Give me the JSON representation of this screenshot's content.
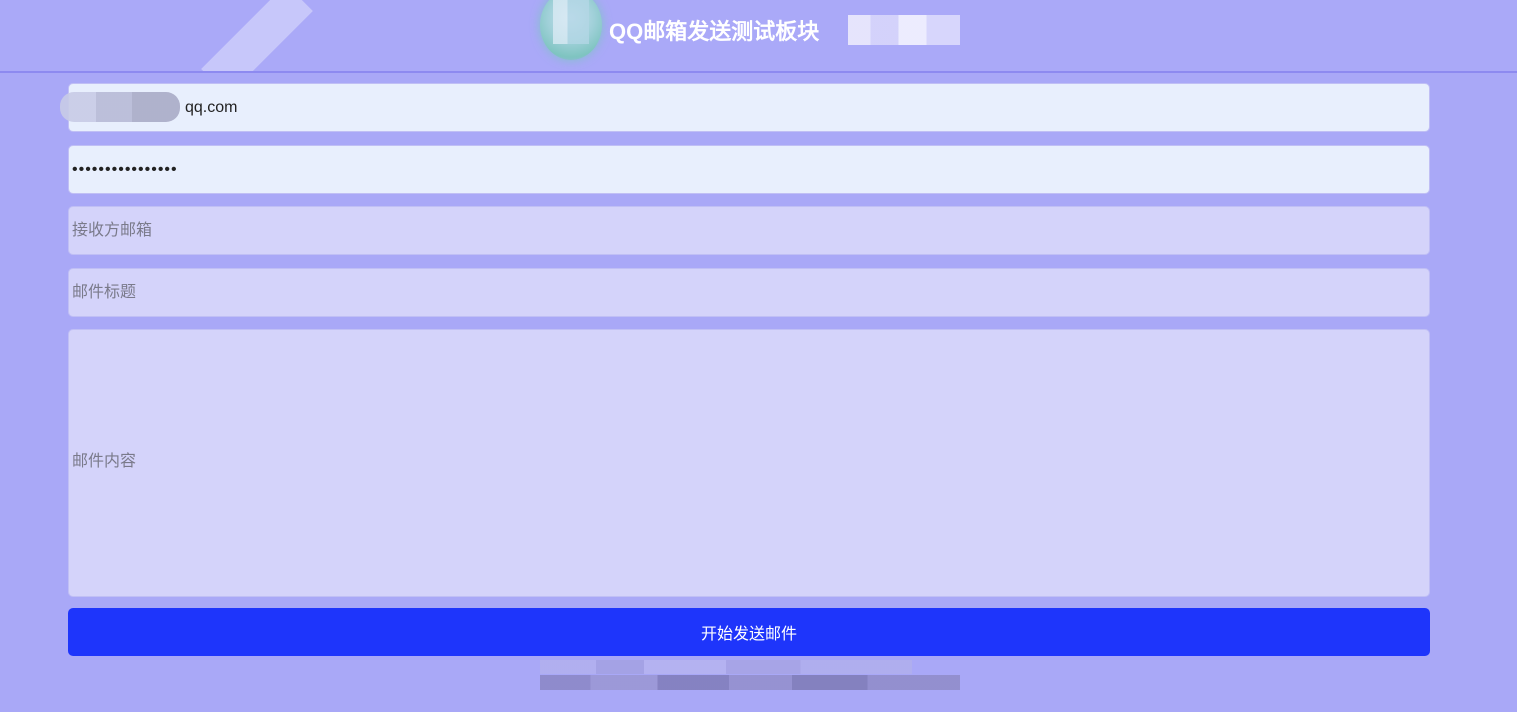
{
  "header": {
    "title": "QQ邮箱发送测试板块"
  },
  "form": {
    "email_value": "qq.com",
    "password_value": "••••••••••••••••",
    "recipient_placeholder": "接收方邮箱",
    "subject_placeholder": "邮件标题",
    "content_placeholder": "邮件内容",
    "send_label": "开始发送邮件"
  },
  "colors": {
    "background": "#a9a8f7",
    "send_button": "#1e35fb",
    "filled_field": "#e8effd",
    "empty_field": "#d4d3fa"
  }
}
